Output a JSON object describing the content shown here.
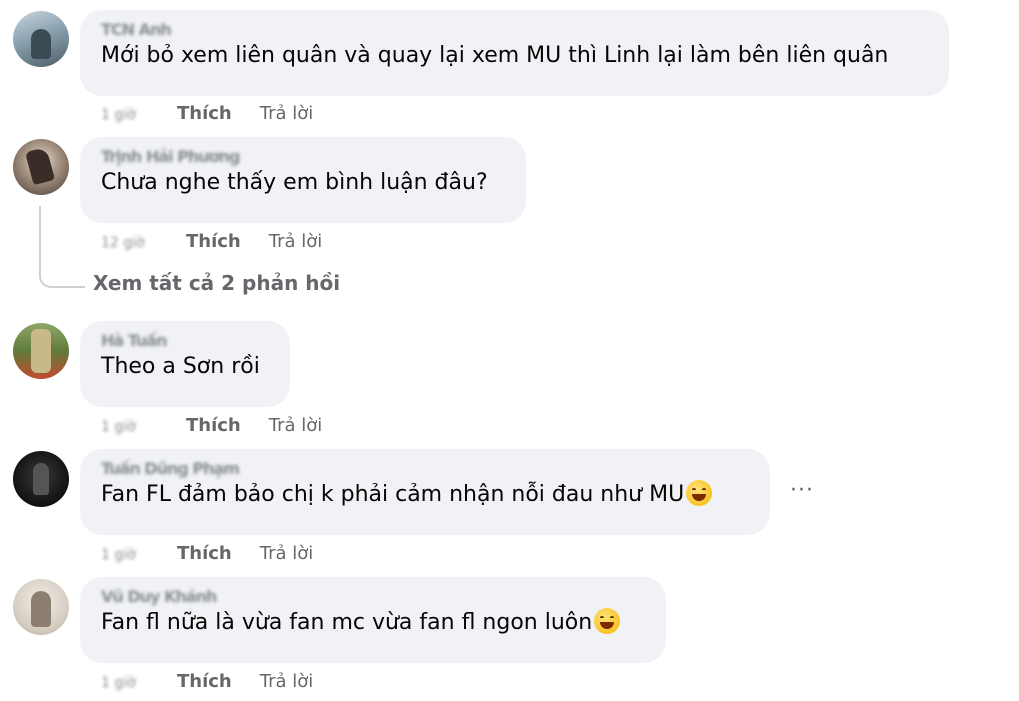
{
  "comments": [
    {
      "author": "TCN Anh",
      "text": "Mới bỏ xem liên quân và quay lại xem MU thì Linh lại làm bên liên quân",
      "time": "1 giờ",
      "like_label": "Thích",
      "reply_label": "Trả lời",
      "avatar_color": "#6f8a9a"
    },
    {
      "author": "Trịnh Hải Phương",
      "text": "Chưa nghe thấy em bình luận đâu?",
      "time": "12 giờ",
      "like_label": "Thích",
      "reply_label": "Trả lời",
      "avatar_color": "#5a4a42"
    },
    {
      "author": "Hà Tuấn",
      "text": "Theo a Sơn rồi",
      "time": "1 giờ",
      "like_label": "Thích",
      "reply_label": "Trả lời",
      "avatar_color": "#5f7b3a"
    },
    {
      "author": "Tuấn Dũng Phạm",
      "text": "Fan FL đảm bảo chị k phải cảm nhận nỗi đau như MU",
      "time": "1 giờ",
      "like_label": "Thích",
      "reply_label": "Trả lời",
      "avatar_color": "#1c1c1c"
    },
    {
      "author": "Vũ Duy Khánh",
      "text": "Fan fl nữa là vừa fan mc vừa fan fl ngon luôn",
      "time": "1 giờ",
      "like_label": "Thích",
      "reply_label": "Trả lời",
      "avatar_color": "#d7cfc4"
    }
  ],
  "view_replies_label": "Xem tất cả 2 phản hồi",
  "more_label": "···"
}
